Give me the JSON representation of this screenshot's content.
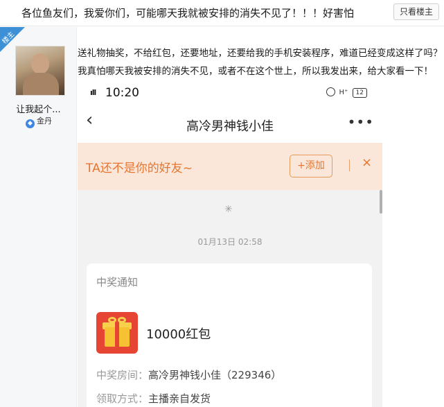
{
  "thread": {
    "title": "各位鱼友们，我爱你们，可能哪天我就被安排的消失不见了！！！好害怕",
    "only_op_label": "只看楼主"
  },
  "author": {
    "op_badge": "楼主",
    "username": "让我起个...",
    "level_icon": "gem-icon",
    "level_label": "金丹"
  },
  "post": {
    "lines": [
      "送礼物抽奖，不给红包，还要地址，还要给我的手机安装程序，难道已经变成这样了吗？",
      "我真怕哪天我被安排的消失不见，或者不在这个世上，所以我发出来，给大家看一下！"
    ]
  },
  "screenshot": {
    "status_bar": {
      "signal": "ıll",
      "time": "10:20",
      "network": "H⁺",
      "battery": "12"
    },
    "chat_header": {
      "back_icon": "chevron-left-icon",
      "contact_name": "高冷男神钱小佳",
      "more_icon": "more-dots-icon",
      "more_glyph": "•••"
    },
    "friend_bar": {
      "message": "TA还不是你的好友~",
      "add_label": "+添加",
      "close_glyph": "×"
    },
    "loading_glyph": "✳",
    "chat_time": "01月13日 02:58",
    "prize_card": {
      "title": "中奖通知",
      "gift_icon": "gift-icon",
      "amount": "10000红包",
      "room_label": "中奖房间：",
      "room_value": "高冷男神钱小佳（229346）",
      "method_label": "领取方式：",
      "method_value": "主播亲自发货"
    }
  },
  "colors": {
    "accent_orange": "#e8752f",
    "friend_bar_bg": "#fae7d9",
    "op_badge_blue": "#3d8fd6",
    "gift_red": "#e64534"
  }
}
